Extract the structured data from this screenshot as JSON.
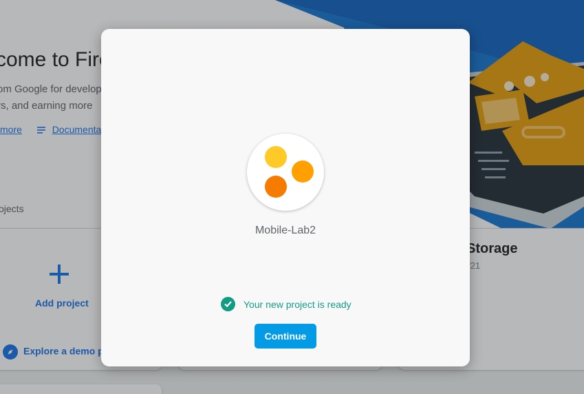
{
  "background": {
    "hero_title": "come to Fire",
    "hero_sub_1": "om Google for develop",
    "hero_sub_2": "rs, and earning more",
    "learn_more": "more",
    "documentation": "Documentat",
    "projects_label": "ojects",
    "add_project": "Add project",
    "explore_demo": "Explore a demo pr",
    "storage_title": "Storage",
    "storage_sub": "f21"
  },
  "dialog": {
    "project_name": "Mobile-Lab2",
    "status_text": "Your new project is ready",
    "continue_label": "Continue"
  },
  "colors": {
    "accent": "#039be5",
    "success": "#129c82",
    "link": "#1a73e8"
  },
  "icons": [
    "plus-icon",
    "compass-icon",
    "document-icon",
    "check-circle-icon",
    "project-logo-icon"
  ]
}
